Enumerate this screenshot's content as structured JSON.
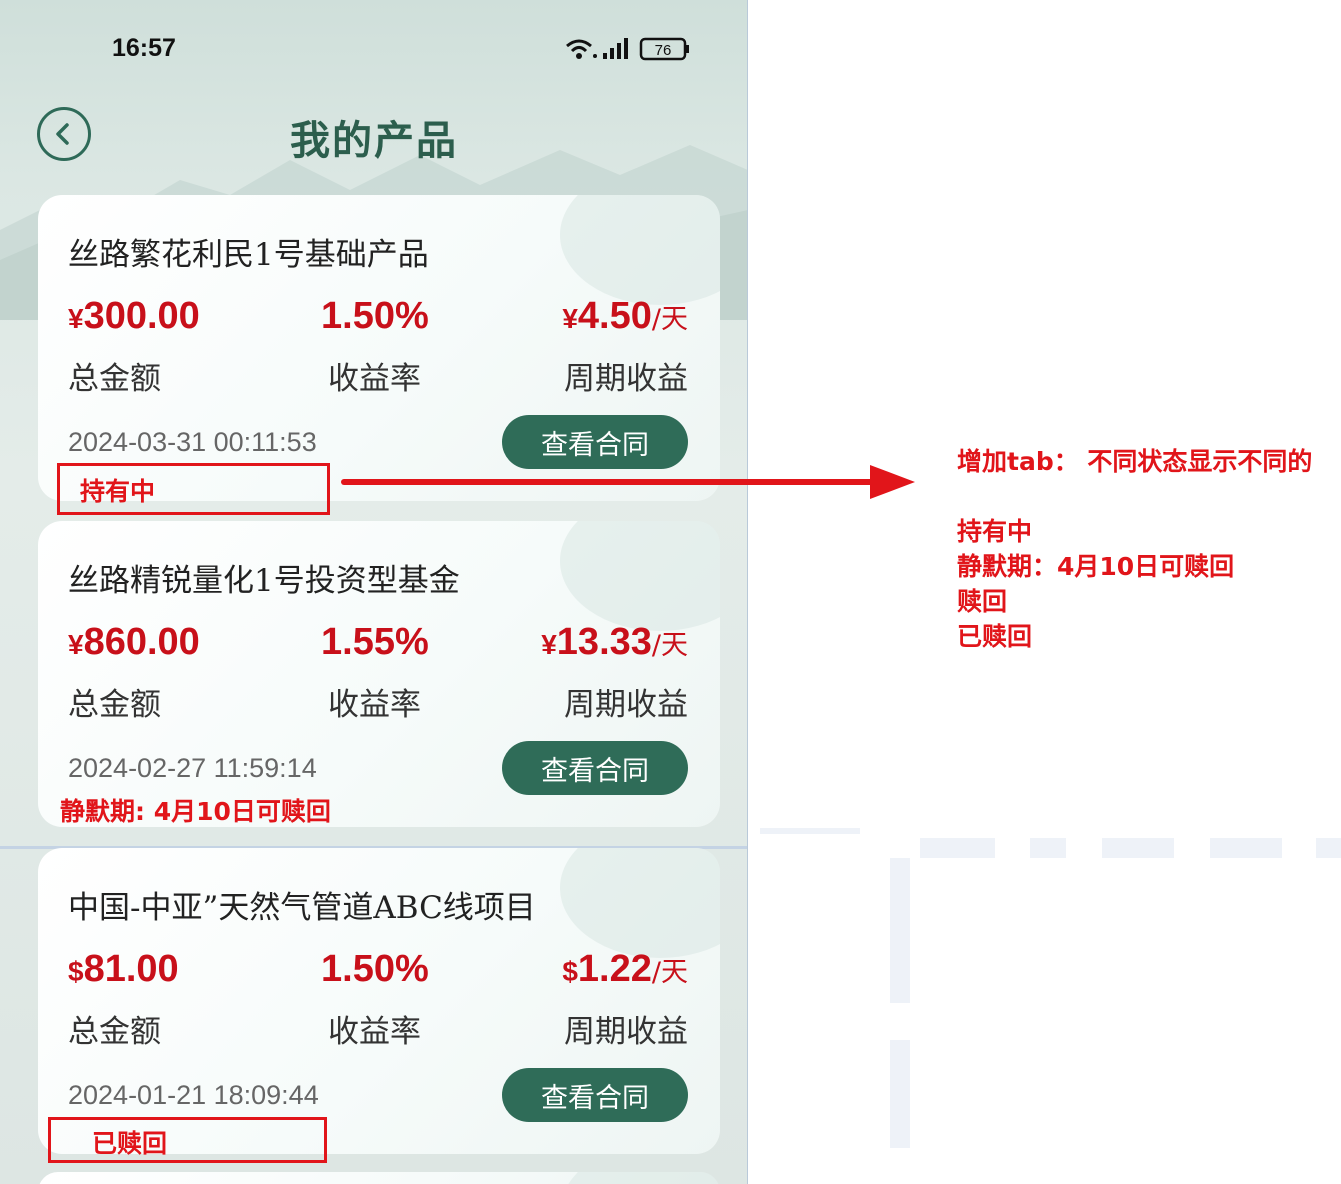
{
  "status_bar": {
    "time": "16:57",
    "battery": "76"
  },
  "header": {
    "title": "我的产品"
  },
  "products": [
    {
      "title": "丝路繁花利民1号基础产品",
      "currency": "¥",
      "amount": "300.00",
      "rate": "1.50%",
      "income_currency": "¥",
      "income": "4.50",
      "income_unit": "/天",
      "amount_label": "总金额",
      "rate_label": "收益率",
      "income_label": "周期收益",
      "date": "2024-03-31 00:11:53",
      "button_label": "查看合同",
      "status": "持有中"
    },
    {
      "title": "丝路精锐量化1号投资型基金",
      "currency": "¥",
      "amount": "860.00",
      "rate": "1.55%",
      "income_currency": "¥",
      "income": "13.33",
      "income_unit": "/天",
      "amount_label": "总金额",
      "rate_label": "收益率",
      "income_label": "周期收益",
      "date": "2024-02-27 11:59:14",
      "button_label": "查看合同",
      "status": "静默期: 4月10日可赎回"
    },
    {
      "title": "中国-中亚”天然气管道ABC线项目",
      "currency": "$",
      "amount": "81.00",
      "rate": "1.50%",
      "income_currency": "$",
      "income": "1.22",
      "income_unit": "/天",
      "amount_label": "总金额",
      "rate_label": "收益率",
      "income_label": "周期收益",
      "date": "2024-01-21 18:09:44",
      "button_label": "查看合同",
      "status": "已赎回"
    }
  ],
  "annotation": {
    "heading": "增加tab： 不同状态显示不同的",
    "states": [
      "持有中",
      "静默期：4月10日可赎回",
      "赎回",
      "已赎回"
    ],
    "color": "#e1151a"
  }
}
